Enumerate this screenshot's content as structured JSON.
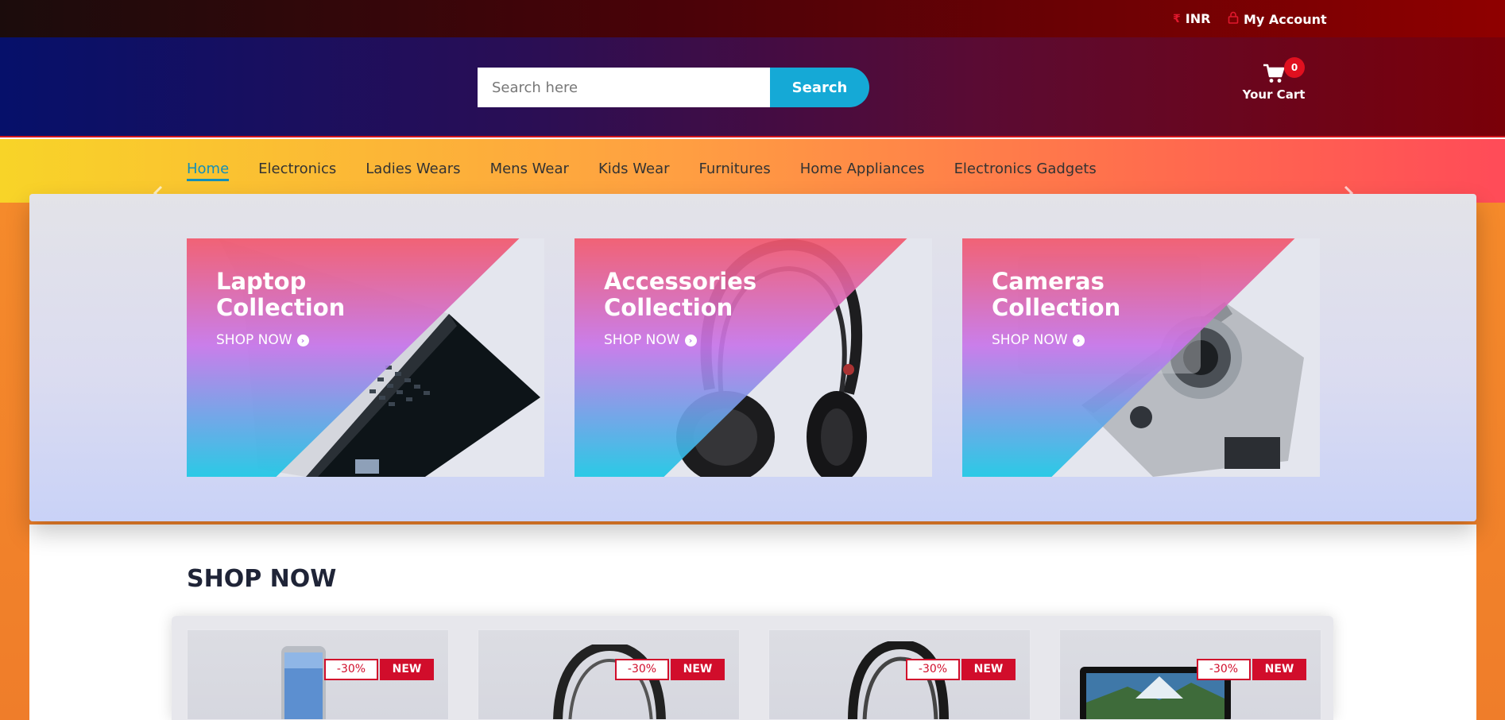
{
  "topbar": {
    "currency_symbol": "₹",
    "currency": "INR",
    "account_label": "My Account"
  },
  "header": {
    "search_placeholder": "Search here",
    "search_button": "Search",
    "cart_count": "0",
    "cart_label": "Your Cart"
  },
  "nav": {
    "items": [
      "Home",
      "Electronics",
      "Ladies Wears",
      "Mens Wear",
      "Kids Wear",
      "Furnitures",
      "Home Appliances",
      "Electronics Gadgets"
    ],
    "active_index": 0
  },
  "banner": {
    "collections": [
      {
        "title_line1": "Laptop",
        "title_line2": "Collection",
        "cta": "SHOP NOW",
        "icon": "laptop-image"
      },
      {
        "title_line1": "Accessories",
        "title_line2": "Collection",
        "cta": "SHOP NOW",
        "icon": "headphones-image"
      },
      {
        "title_line1": "Cameras",
        "title_line2": "Collection",
        "cta": "SHOP NOW",
        "icon": "camera-image"
      }
    ]
  },
  "shop": {
    "heading": "SHOP NOW",
    "products": [
      {
        "discount": "-30%",
        "tag": "NEW",
        "icon": "smartphone-image"
      },
      {
        "discount": "-30%",
        "tag": "NEW",
        "icon": "headphones-image"
      },
      {
        "discount": "-30%",
        "tag": "NEW",
        "icon": "headphones-image"
      },
      {
        "discount": "-30%",
        "tag": "NEW",
        "icon": "laptop-image"
      }
    ]
  },
  "colors": {
    "accent_blue": "#15a9d6",
    "badge_red": "#d10d2b",
    "active_nav": "#138fb8"
  }
}
